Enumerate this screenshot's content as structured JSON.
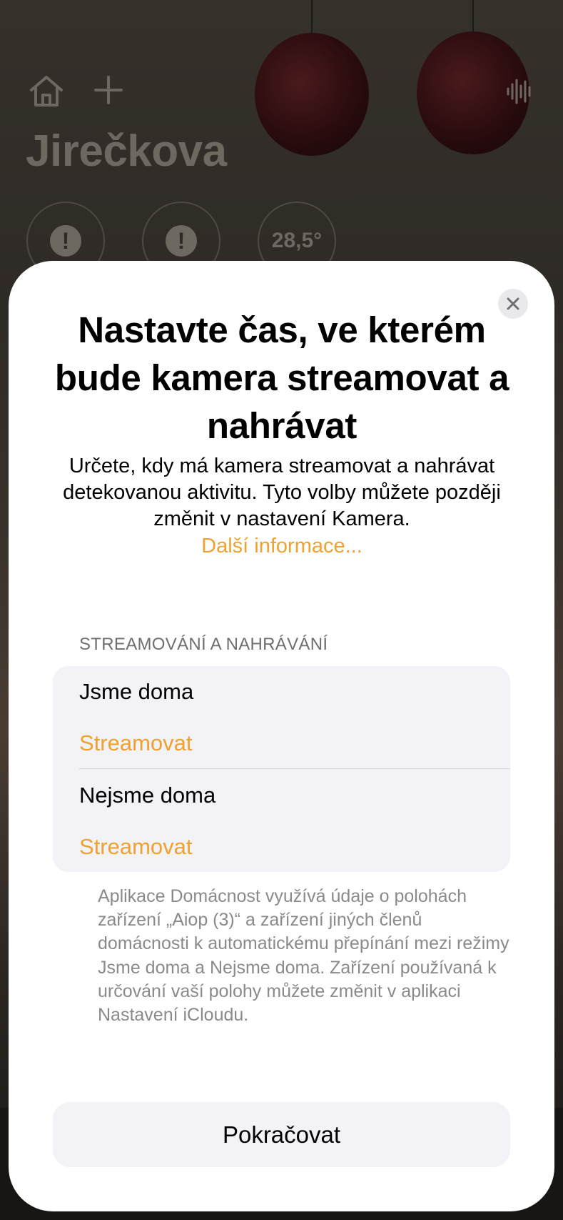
{
  "background": {
    "home_title": "Jirečkova",
    "status_items": [
      {
        "type": "alert",
        "text": "!"
      },
      {
        "type": "alert",
        "text": "!"
      },
      {
        "type": "temperature",
        "text": "28,5°"
      }
    ],
    "icons": [
      "home-icon",
      "plus-icon",
      "waveform-icon"
    ]
  },
  "sheet": {
    "title": "Nastavte čas, ve kterém bude kamera streamovat a nahrávat",
    "description": "Určete, kdy má kamera streamovat a nahrávat detekovanou aktivitu. Tyto volby můžete později změnit v nastavení Kamera.",
    "more_link": "Další informace...",
    "section_header": "STREAMOVÁNÍ A NAHRÁVÁNÍ",
    "rows": [
      {
        "label": "Jsme doma",
        "value": "Streamovat"
      },
      {
        "label": "Nejsme doma",
        "value": "Streamovat"
      }
    ],
    "footnote": "Aplikace Domácnost využívá údaje o polohách zařízení „Aiop (3)“ a zařízení jiných členů domácnosti k automatickému přepínání mezi režimy Jsme doma a Nejsme doma. Zařízení používaná k určování vaší polohy můžete změnit v aplikaci Nastavení iCloudu.",
    "continue_label": "Pokračovat"
  },
  "colors": {
    "accent": "#f0a230",
    "grouped_background": "#f2f2f7",
    "secondary_text": "#8a8a8e"
  }
}
